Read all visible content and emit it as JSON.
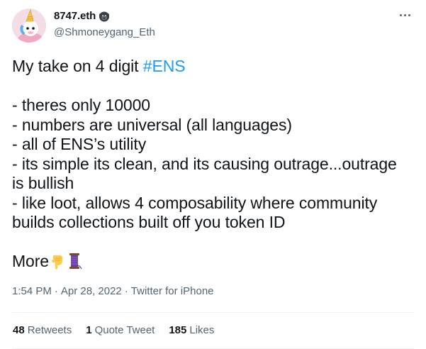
{
  "author": {
    "display_name": "8747.eth",
    "handle": "@Shmoneygang_Eth",
    "badge_icon": "gorilla-icon"
  },
  "tweet": {
    "line1_prefix": "My take on 4 digit ",
    "hashtag": "#ENS",
    "lines": [
      "- theres only 10000",
      "- numbers are universal (all languages)",
      "- all of ENS’s utility",
      "- its simple its clean, and its causing outrage...outrage",
      "is bullish",
      "- like loot, allows 4 composability where community",
      "builds collections built off you token ID"
    ],
    "more_text": "More",
    "emojis": [
      "pointing-down-icon",
      "thread-icon"
    ]
  },
  "meta": {
    "time": "1:54 PM",
    "sep": "·",
    "date": "Apr 28, 2022",
    "source": "Twitter for iPhone"
  },
  "stats": {
    "retweets_count": "48",
    "retweets_label": "Retweets",
    "quotes_count": "1",
    "quotes_label": "Quote Tweet",
    "likes_count": "185",
    "likes_label": "Likes"
  },
  "colors": {
    "link": "#1d9bf0",
    "secondary": "#536471",
    "text": "#0f1419",
    "divider": "#eff3f4"
  }
}
